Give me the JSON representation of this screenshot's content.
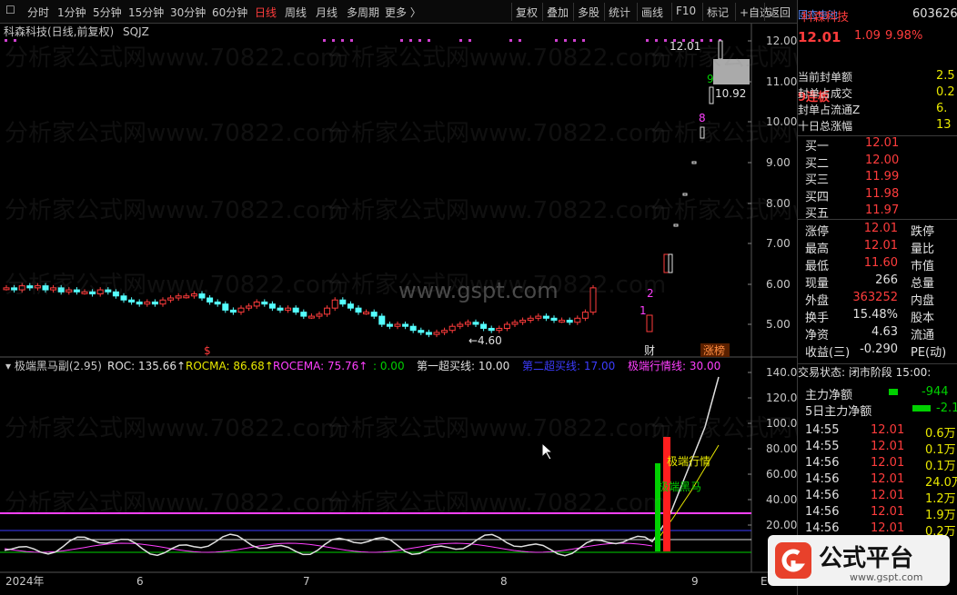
{
  "toolbar": {
    "left": [
      "分时",
      "1分钟",
      "5分钟",
      "15分钟",
      "30分钟",
      "60分钟",
      "日线",
      "周线",
      "月线",
      "多周期",
      "更多 〉"
    ],
    "active": "日线",
    "right": [
      "复权",
      "叠加",
      "多股",
      "统计",
      "画线",
      "F10",
      "标记",
      "+自选",
      "返回"
    ]
  },
  "chart": {
    "title": "科森科技(日线,前复权)",
    "indicator": "SQJZ",
    "yaxis": [
      "12.00",
      "11.00",
      "10.00",
      "9.00",
      "8.00",
      "7.00",
      "6.00",
      "5.00"
    ],
    "labels": {
      "high": "12.01",
      "hi2": "10.92",
      "low": "4.60"
    },
    "counts": [
      "1",
      "2",
      "8",
      "9"
    ],
    "marks": {
      "s": "$",
      "cai": "财",
      "zhang": "涨榜"
    }
  },
  "sub": {
    "name": "极端黑马副(2.95)",
    "items": [
      {
        "t": "ROC: 135.66↑",
        "c": "#e0e0e0"
      },
      {
        "t": "ROCMA: 86.68↑",
        "c": "#e8e800"
      },
      {
        "t": "ROCEMA: 75.76↑",
        "c": "#ff40ff"
      },
      {
        "t": ": 0.00",
        "c": "#00d000"
      },
      {
        "t": "第一超买线: 10.00",
        "c": "#e0e0e0"
      },
      {
        "t": "第二超买线: 17.00",
        "c": "#3c3cff"
      },
      {
        "t": "极端行情线: 30.00",
        "c": "#ff40ff"
      }
    ],
    "yaxis": [
      "140.00",
      "120.00",
      "100.00",
      "80.00",
      "60.00",
      "40.00",
      "20.00"
    ],
    "label1": "极端行情",
    "label2": "极端黑马"
  },
  "xaxis": [
    "2024年",
    "6",
    "7",
    "8",
    "9"
  ],
  "xaxis_end": "E",
  "watermark": "分析家公式网www.70822.com",
  "center_wm": "www.gspt.com",
  "right": {
    "name": "科森科技",
    "concept": "固态电池",
    "code": "603626",
    "price": "12.01",
    "change": "1.09",
    "pct": "9.98%",
    "streak": "9连板",
    "seal": [
      "当前封单额 2.5",
      "封单占成交 0.2",
      "封单占流通Z 6.",
      "十日总涨幅 13"
    ],
    "bids": [
      [
        "买一",
        "12.01"
      ],
      [
        "买二",
        "12.00"
      ],
      [
        "买三",
        "11.99"
      ],
      [
        "买四",
        "11.98"
      ],
      [
        "买五",
        "11.97"
      ]
    ],
    "stats": [
      [
        "涨停",
        "12.01",
        "跌停",
        ""
      ],
      [
        "最高",
        "12.01",
        "量比",
        ""
      ],
      [
        "最低",
        "11.60",
        "市值",
        ""
      ],
      [
        "现量",
        "266",
        "总量",
        ""
      ],
      [
        "外盘",
        "363252",
        "内盘",
        ""
      ],
      [
        "换手",
        "15.48%",
        "股本",
        ""
      ],
      [
        "净资",
        "4.63",
        "流通",
        ""
      ],
      [
        "收益(三)",
        "-0.290",
        "PE(动)",
        ""
      ]
    ],
    "status": "交易状态: 闭市阶段 15:00:",
    "flow": [
      [
        "主力净额",
        "-944"
      ],
      [
        "5日主力净额",
        "-2.1"
      ]
    ],
    "ticks": [
      [
        "14:55",
        "12.01",
        "0.6万"
      ],
      [
        "14:55",
        "12.01",
        "0.1万"
      ],
      [
        "14:56",
        "12.01",
        "0.1万"
      ],
      [
        "14:56",
        "12.01",
        "24.0万"
      ],
      [
        "14:56",
        "12.01",
        "1.2万"
      ],
      [
        "14:56",
        "12.01",
        "1.9万"
      ],
      [
        "14:56",
        "12.01",
        "0.2万"
      ]
    ]
  },
  "logo": {
    "text": "公式平台",
    "url": "www.gspt.com"
  }
}
